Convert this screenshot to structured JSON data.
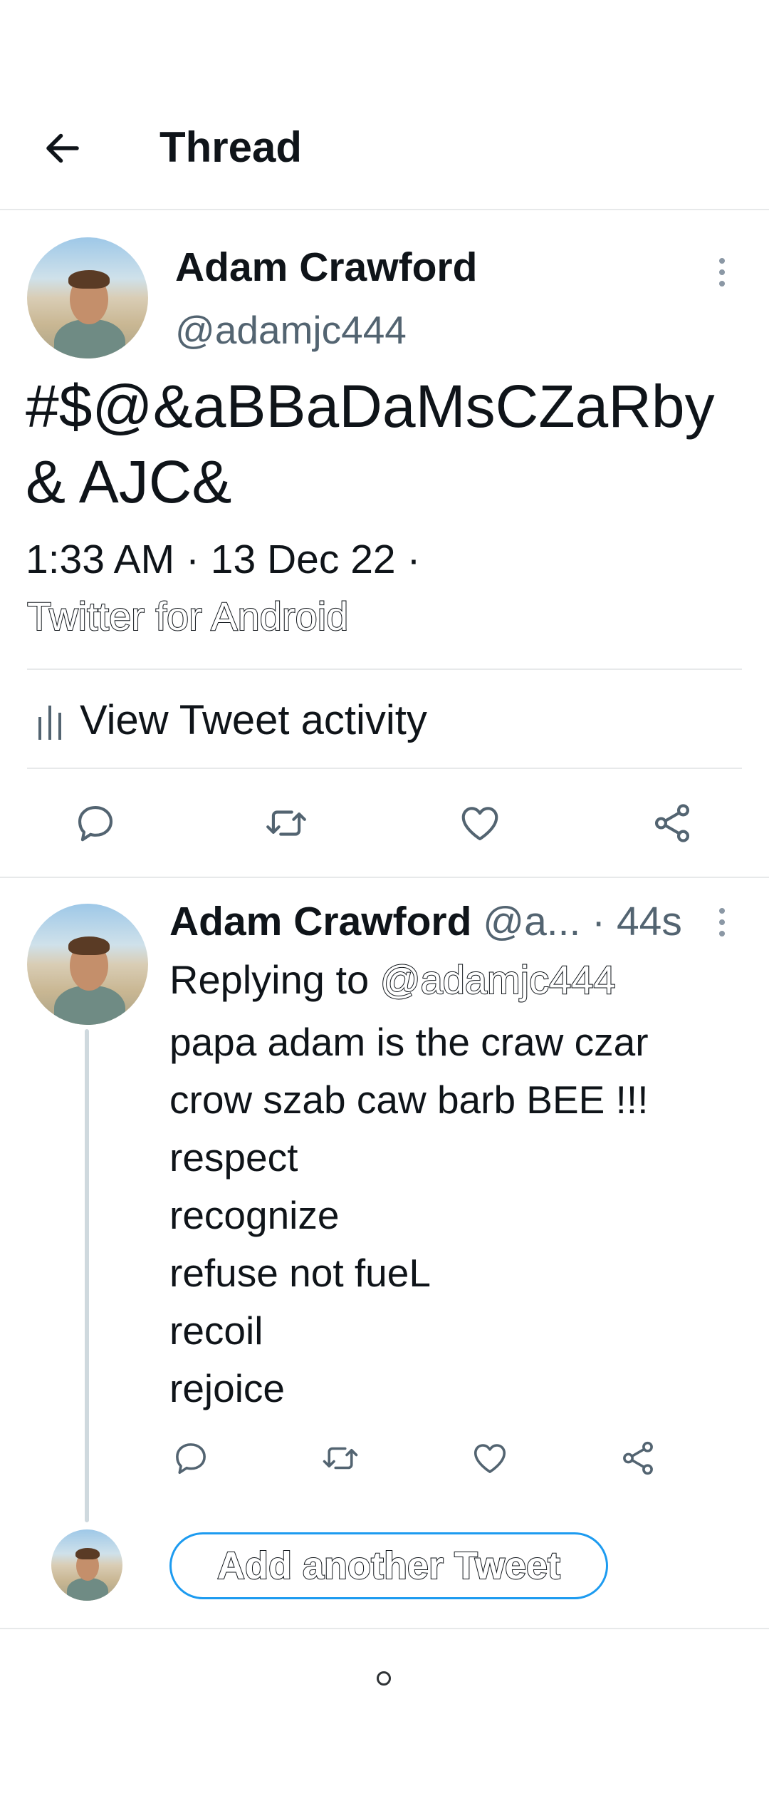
{
  "header": {
    "title": "Thread"
  },
  "main_tweet": {
    "author_name": "Adam Crawford",
    "handle": "@adamjc444",
    "text_line1": "#$@&aBBaDaMsCZaRby",
    "text_line2": "& AJC&",
    "timestamp": "1:33 AM · 13 Dec 22 ·",
    "source": "Twitter for Android",
    "activity_label": "View Tweet activity"
  },
  "reply": {
    "author_name": "Adam Crawford",
    "handle_truncated": "@a...",
    "age": "· 44s",
    "replying_prefix": "Replying to ",
    "replying_handle": "@adamjc444",
    "lines": [
      "papa adam is the craw czar",
      "crow szab caw barb BEE !!!",
      "respect",
      "recognize",
      "refuse not fueL",
      "recoil",
      "rejoice"
    ]
  },
  "composer": {
    "add_label": "Add another Tweet"
  },
  "colors": {
    "accent": "#1d9bf0",
    "text": "#0f1419",
    "muted": "#536471",
    "divider": "#e7e9ea"
  },
  "icons": [
    "back-arrow-icon",
    "more-vertical-icon",
    "activity-bars-icon",
    "reply-icon",
    "retweet-icon",
    "like-icon",
    "share-icon",
    "home-indicator-icon"
  ]
}
